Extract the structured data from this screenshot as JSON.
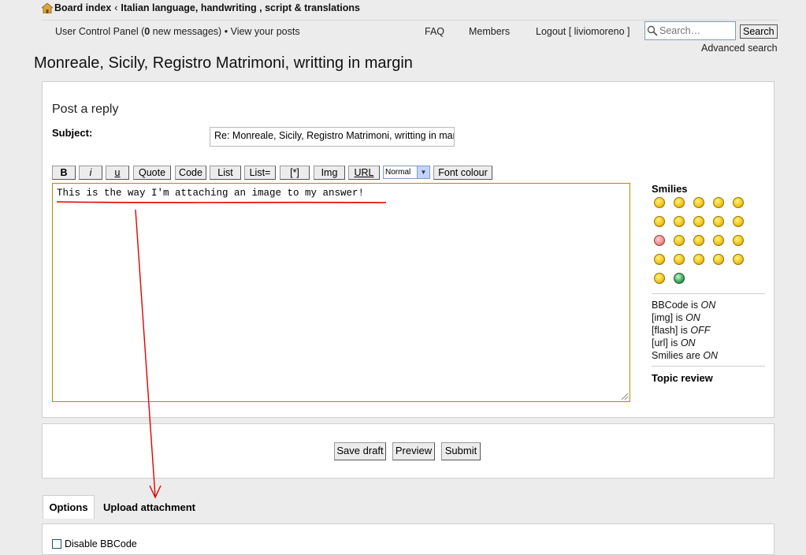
{
  "breadcrumb": {
    "home": "Board index",
    "separator": "‹",
    "forum": "Italian language, handwriting , script & translations"
  },
  "nav": {
    "ucp_prefix": "User Control Panel (",
    "new_messages_count": "0",
    "ucp_suffix": " new messages)",
    "bullet": "•",
    "view_posts": "View your posts",
    "faq": "FAQ",
    "members": "Members",
    "logout": "Logout [ liviomoreno ]"
  },
  "search": {
    "placeholder": "Search…",
    "button": "Search",
    "advanced": "Advanced search"
  },
  "page_title": "Monreale, Sicily, Registro Matrimoni, writting in margin",
  "form": {
    "heading": "Post a reply",
    "subject_label": "Subject:",
    "subject_value": "Re: Monreale, Sicily, Registro Matrimoni, writting in margin",
    "message": "This is the way I'm attaching an image to my answer!"
  },
  "toolbar": {
    "bold": "B",
    "italic": "i",
    "underline": "u",
    "quote": "Quote",
    "code": "Code",
    "list": "List",
    "list_ordered": "List=",
    "list_item": "[*]",
    "img": "Img",
    "url": "URL",
    "font_size": "Normal",
    "font_colour": "Font colour"
  },
  "sidebar": {
    "smilies_label": "Smilies",
    "smilies": [
      "very-happy-icon",
      "smile-icon",
      "sad-icon",
      "surprised-icon",
      "shocked-icon",
      "confused-icon",
      "cool-icon",
      "laughing-icon",
      "mad-icon",
      "razz-icon",
      "embarrassed-icon",
      "crying-icon",
      "evil-icon",
      "twisted-evil-icon",
      "rolling-eyes-icon",
      "wink-icon",
      "exclaim-icon",
      "question-icon",
      "idea-icon",
      "arrow-icon",
      "neutral-icon",
      "mr-green-icon"
    ],
    "bbcode": {
      "label": "BBCode",
      "is": " is ",
      "value": "ON"
    },
    "img": {
      "label": "[img]",
      "is": " is ",
      "value": "ON"
    },
    "flash": {
      "label": "[flash]",
      "is": " is ",
      "value": "OFF"
    },
    "url": {
      "label": "[url]",
      "is": " is ",
      "value": "ON"
    },
    "smilies_status": {
      "label": "Smilies",
      "is": " are ",
      "value": "ON"
    },
    "topic_review": "Topic review"
  },
  "submit": {
    "save_draft": "Save draft",
    "preview": "Preview",
    "submit": "Submit"
  },
  "tabs": {
    "options": "Options",
    "upload": "Upload attachment"
  },
  "options": {
    "disable_bbcode": "Disable BBCode"
  },
  "colors": {
    "annotation": "#e00000",
    "textarea_border": "#b8860b"
  }
}
